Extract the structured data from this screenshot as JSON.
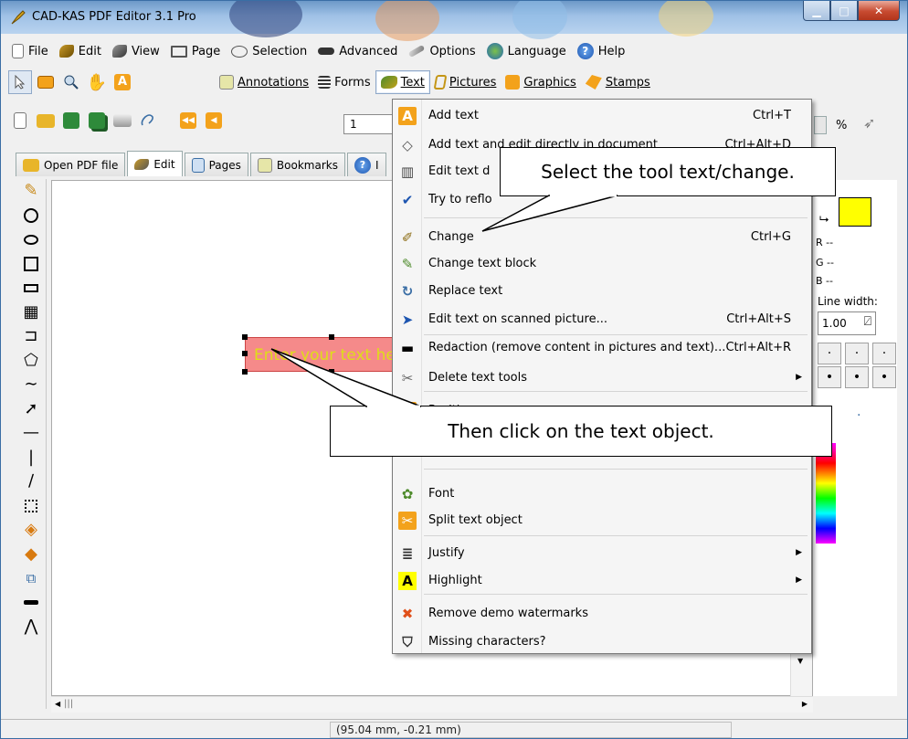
{
  "window": {
    "title": "CAD-KAS PDF Editor 3.1 Pro"
  },
  "menubar": [
    {
      "label": "File",
      "icon": "file-icon"
    },
    {
      "label": "Edit",
      "icon": "edit-icon"
    },
    {
      "label": "View",
      "icon": "view-icon"
    },
    {
      "label": "Page",
      "icon": "page-icon"
    },
    {
      "label": "Selection",
      "icon": "selection-icon"
    },
    {
      "label": "Advanced",
      "icon": "advanced-icon"
    },
    {
      "label": "Options",
      "icon": "options-icon"
    },
    {
      "label": "Language",
      "icon": "language-icon"
    },
    {
      "label": "Help",
      "icon": "help-icon"
    }
  ],
  "toolbar1": {
    "annotations": "Annotations",
    "forms": "Forms",
    "text": "Text",
    "pictures": "Pictures",
    "graphics": "Graphics",
    "stamps": "Stamps"
  },
  "toolbar2": {
    "page_number": "1",
    "zoom_unit": "%"
  },
  "tabs": [
    {
      "label": "Open PDF file"
    },
    {
      "label": "Edit"
    },
    {
      "label": "Pages"
    },
    {
      "label": "Bookmarks"
    },
    {
      "label": "I"
    }
  ],
  "canvas": {
    "textbox": "Enter your text here"
  },
  "text_menu": [
    {
      "label": "Add text",
      "shortcut": "Ctrl+T",
      "icon": "letter-a-icon"
    },
    {
      "label": "Add text and edit directly in document",
      "shortcut": "Ctrl+Alt+D",
      "icon": "eraser-icon"
    },
    {
      "label": "Edit text d",
      "shortcut": "",
      "icon": "book-icon"
    },
    {
      "label": "Try to reflo",
      "shortcut": "",
      "icon": "checkmark-icon"
    },
    {
      "label": "Change",
      "shortcut": "Ctrl+G",
      "icon": "pen-icon"
    },
    {
      "label": "Change text block",
      "shortcut": "",
      "icon": "notepad-icon"
    },
    {
      "label": "Replace text",
      "shortcut": "",
      "icon": "replace-icon"
    },
    {
      "label": "Edit text on scanned picture...",
      "shortcut": "Ctrl+Alt+S",
      "icon": "arrow-right-icon"
    },
    {
      "label": "Redaction (remove content in pictures and text)...",
      "shortcut": "Ctrl+Alt+R",
      "icon": "redaction-icon"
    },
    {
      "label": "Delete text tools",
      "shortcut": "",
      "icon": "delete-icon",
      "submenu": true
    },
    {
      "label": "Position...",
      "shortcut": "",
      "icon": "position-icon"
    },
    {
      "label": "Font",
      "shortcut": "",
      "icon": "font-icon"
    },
    {
      "label": "Split text object",
      "shortcut": "",
      "icon": "split-icon"
    },
    {
      "label": "Justify",
      "shortcut": "",
      "icon": "justify-icon",
      "submenu": true
    },
    {
      "label": "Highlight",
      "shortcut": "",
      "icon": "highlight-icon",
      "submenu": true
    },
    {
      "label": "Remove demo watermarks",
      "shortcut": "",
      "icon": "remove-icon"
    },
    {
      "label": "Missing characters?",
      "shortcut": "",
      "icon": "grad-cap-icon"
    }
  ],
  "callouts": {
    "top": "Select the tool text/change.",
    "bottom": "Then click on the text object."
  },
  "right_panel": {
    "r": "R --",
    "g": "G --",
    "b": "B --",
    "line_width_label": "Line width:",
    "line_width_value": "1.00",
    "swatch_color": "#ffff00"
  },
  "status": {
    "coords": "(95.04 mm, -0.21 mm)"
  }
}
